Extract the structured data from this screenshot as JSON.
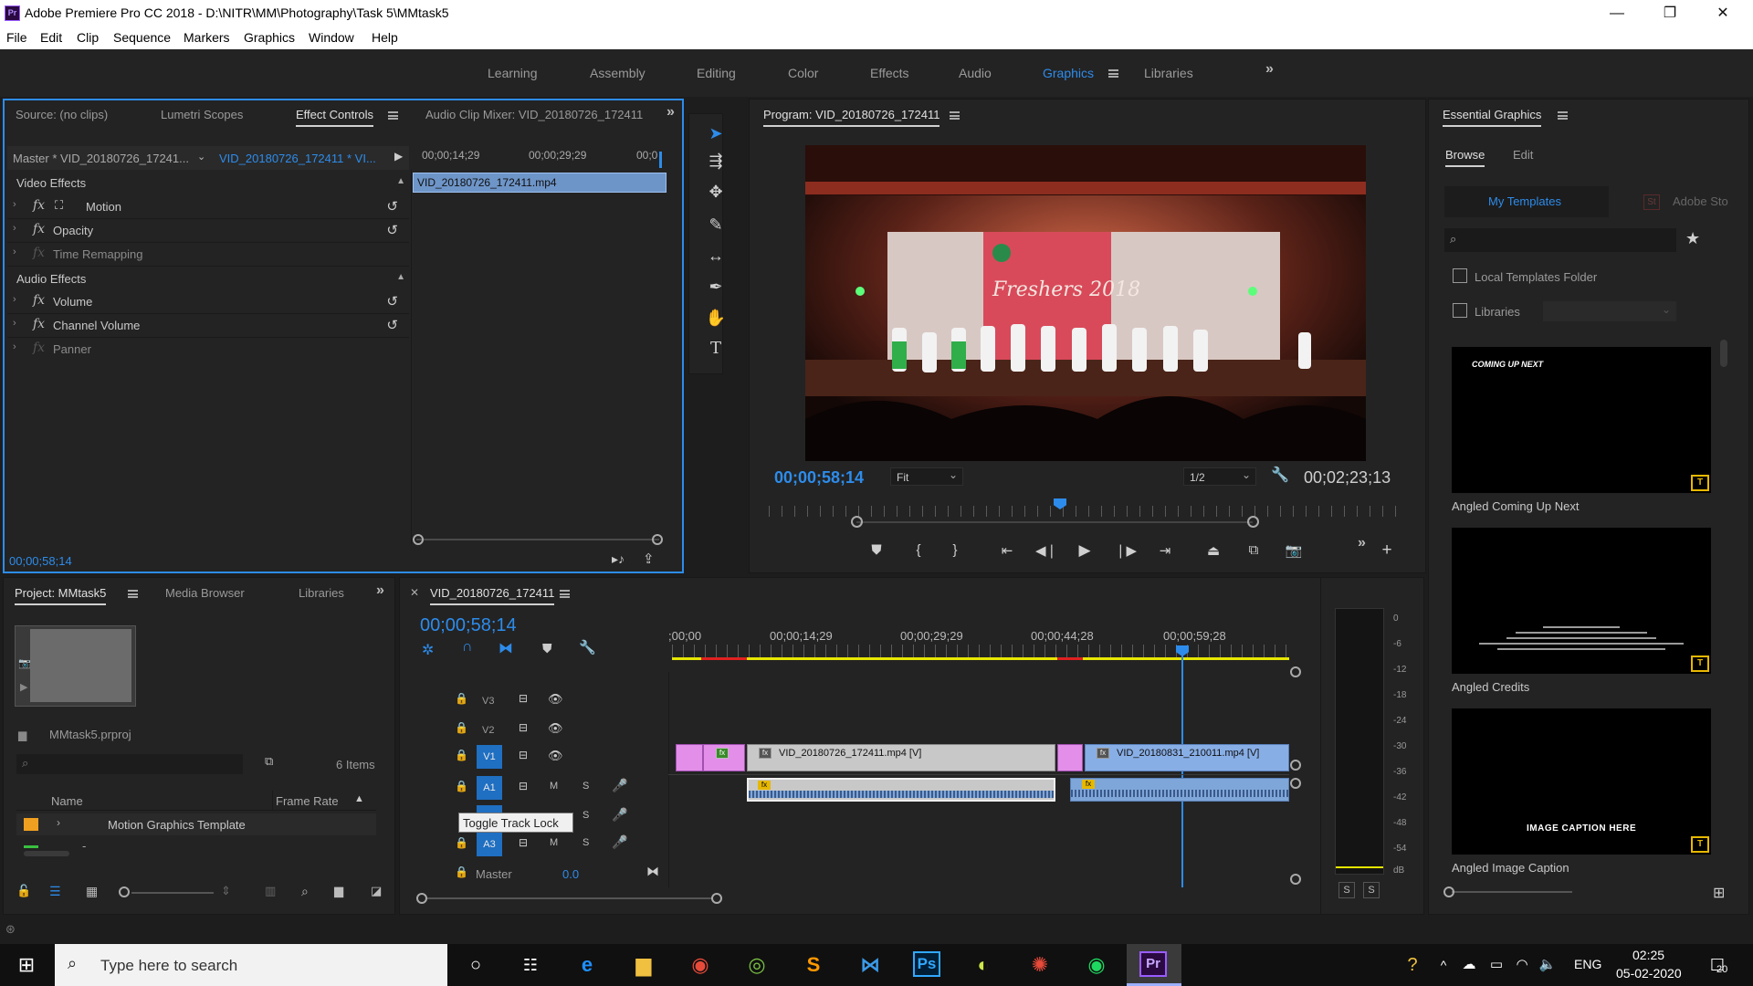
{
  "window": {
    "title": "Adobe Premiere Pro CC 2018 - D:\\NITR\\MM\\Photography\\Task 5\\MMtask5",
    "app_icon": "Pr",
    "minimize": "—",
    "restore": "❐",
    "close": "✕"
  },
  "menu": [
    "File",
    "Edit",
    "Clip",
    "Sequence",
    "Markers",
    "Graphics",
    "Window",
    "Help"
  ],
  "workspaces": [
    "Learning",
    "Assembly",
    "Editing",
    "Color",
    "Effects",
    "Audio",
    "Graphics",
    "Libraries"
  ],
  "active_workspace": "Graphics",
  "overflow": "»",
  "source_panel": {
    "tabs": [
      "Source: (no clips)",
      "Lumetri Scopes",
      "Effect Controls",
      "Audio Clip Mixer: VID_20180726_172411"
    ],
    "active_tab": "Effect Controls",
    "master_label": "Master * VID_20180726_17241...",
    "clip_label": "VID_20180726_172411 * VI...",
    "ruler": [
      "00;00;14;29",
      "00;00;29;29",
      "00;0"
    ],
    "clip_bar": "VID_20180726_172411.mp4",
    "video_effects_header": "Video Effects",
    "audio_effects_header": "Audio Effects",
    "video_effects": [
      {
        "name": "Motion",
        "has_reset": true,
        "dim": false
      },
      {
        "name": "Opacity",
        "has_reset": true,
        "dim": false
      },
      {
        "name": "Time Remapping",
        "has_reset": false,
        "dim": true
      }
    ],
    "audio_effects": [
      {
        "name": "Volume",
        "has_reset": true,
        "dim": false
      },
      {
        "name": "Channel Volume",
        "has_reset": true,
        "dim": false
      },
      {
        "name": "Panner",
        "has_reset": false,
        "dim": true
      }
    ],
    "fx_glyph": "fx",
    "timecode": "00;00;58;14"
  },
  "program_monitor": {
    "title": "Program: VID_20180726_172411",
    "timecode": "00;00;58;14",
    "fit": "Fit",
    "resolution": "1/2",
    "duration": "00;02;23;13",
    "banner_text": "Freshers 2018"
  },
  "project_panel": {
    "tabs": [
      "Project: MMtask5",
      "Media Browser",
      "Libraries"
    ],
    "active_tab": "Project: MMtask5",
    "project_file": "MMtask5.prproj",
    "items_count": "6 Items",
    "col_name": "Name",
    "col_frame_rate": "Frame Rate",
    "row1": "Motion Graphics Template",
    "row2": "-"
  },
  "timeline": {
    "sequence_name": "VID_20180726_172411",
    "timecode": "00;00;58;14",
    "ruler": [
      ";00;00",
      "00;00;14;29",
      "00;00;29;29",
      "00;00;44;28",
      "00;00;59;28"
    ],
    "video_tracks": [
      "V3",
      "V2",
      "V1"
    ],
    "audio_tracks": [
      "A1",
      "A2",
      "A3"
    ],
    "master_label": "Master",
    "master_value": "0.0",
    "clip1": "VID_20180726_172411.mp4 [V]",
    "clip2": "VID_20180831_210011.mp4 [V]",
    "tooltip": "Toggle Track Lock",
    "mute": "M",
    "solo": "S"
  },
  "meter": {
    "scale": [
      "0",
      "-6",
      "-12",
      "-18",
      "-24",
      "-30",
      "-36",
      "-42",
      "-48",
      "-54",
      "dB"
    ],
    "solo_left": "S",
    "solo_right": "S"
  },
  "essential_graphics": {
    "title": "Essential Graphics",
    "tabs": [
      "Browse",
      "Edit"
    ],
    "active_tab": "Browse",
    "subtabs": [
      "My Templates",
      "Adobe Stock"
    ],
    "subtab_stock_display": "Adobe Sto",
    "stock_icon": "St",
    "search_placeholder": "",
    "local_templates": "Local Templates Folder",
    "libraries": "Libraries",
    "templates": [
      {
        "name": "Angled Coming Up Next",
        "preview_text": "COMING UP NEXT"
      },
      {
        "name": "Angled Credits",
        "preview_text": "COMPANY NAME"
      },
      {
        "name": "Angled Image Caption",
        "preview_text": "IMAGE CAPTION HERE"
      }
    ]
  },
  "taskbar": {
    "search_placeholder": "Type here to search",
    "language": "ENG",
    "time": "02:25",
    "date": "05-02-2020",
    "notification_count": "20"
  },
  "colors": {
    "accent": "#2d8ceb",
    "panel": "#232323",
    "background": "#1d1d1d",
    "clip_pink": "#e38ee8",
    "audio_clip": "#7fa6d9",
    "work_area": "#e6e600",
    "render_red": "#e02020"
  }
}
